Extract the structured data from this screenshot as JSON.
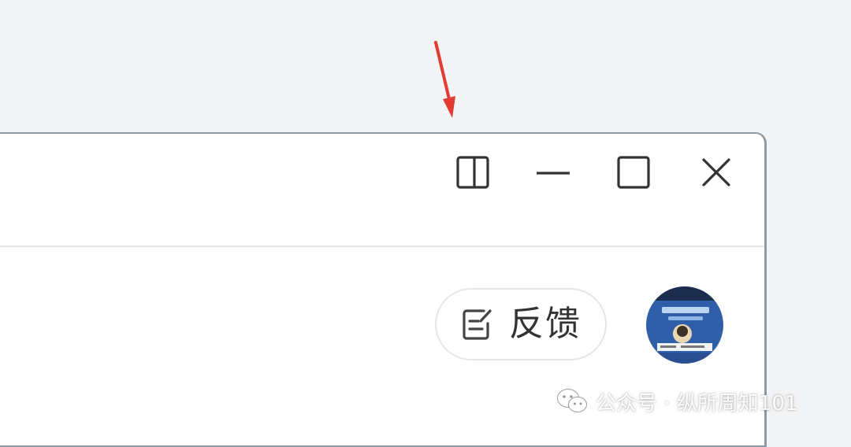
{
  "window": {
    "controls": {
      "split_icon": "split-view-icon",
      "minimize_icon": "minimize-icon",
      "maximize_icon": "maximize-icon",
      "close_icon": "close-icon"
    }
  },
  "toolbar": {
    "feedback_icon": "edit-note-icon",
    "feedback_label": "反馈",
    "avatar": "user-avatar"
  },
  "annotation": {
    "arrow_color": "#e23b34"
  },
  "watermark": {
    "icon": "wechat-icon",
    "text": "公众号 · 纵所周知101"
  },
  "colors": {
    "background": "#f3f4f6",
    "window_border": "#8e9aa6",
    "divider": "#e3e6ea",
    "icon": "#333333"
  }
}
